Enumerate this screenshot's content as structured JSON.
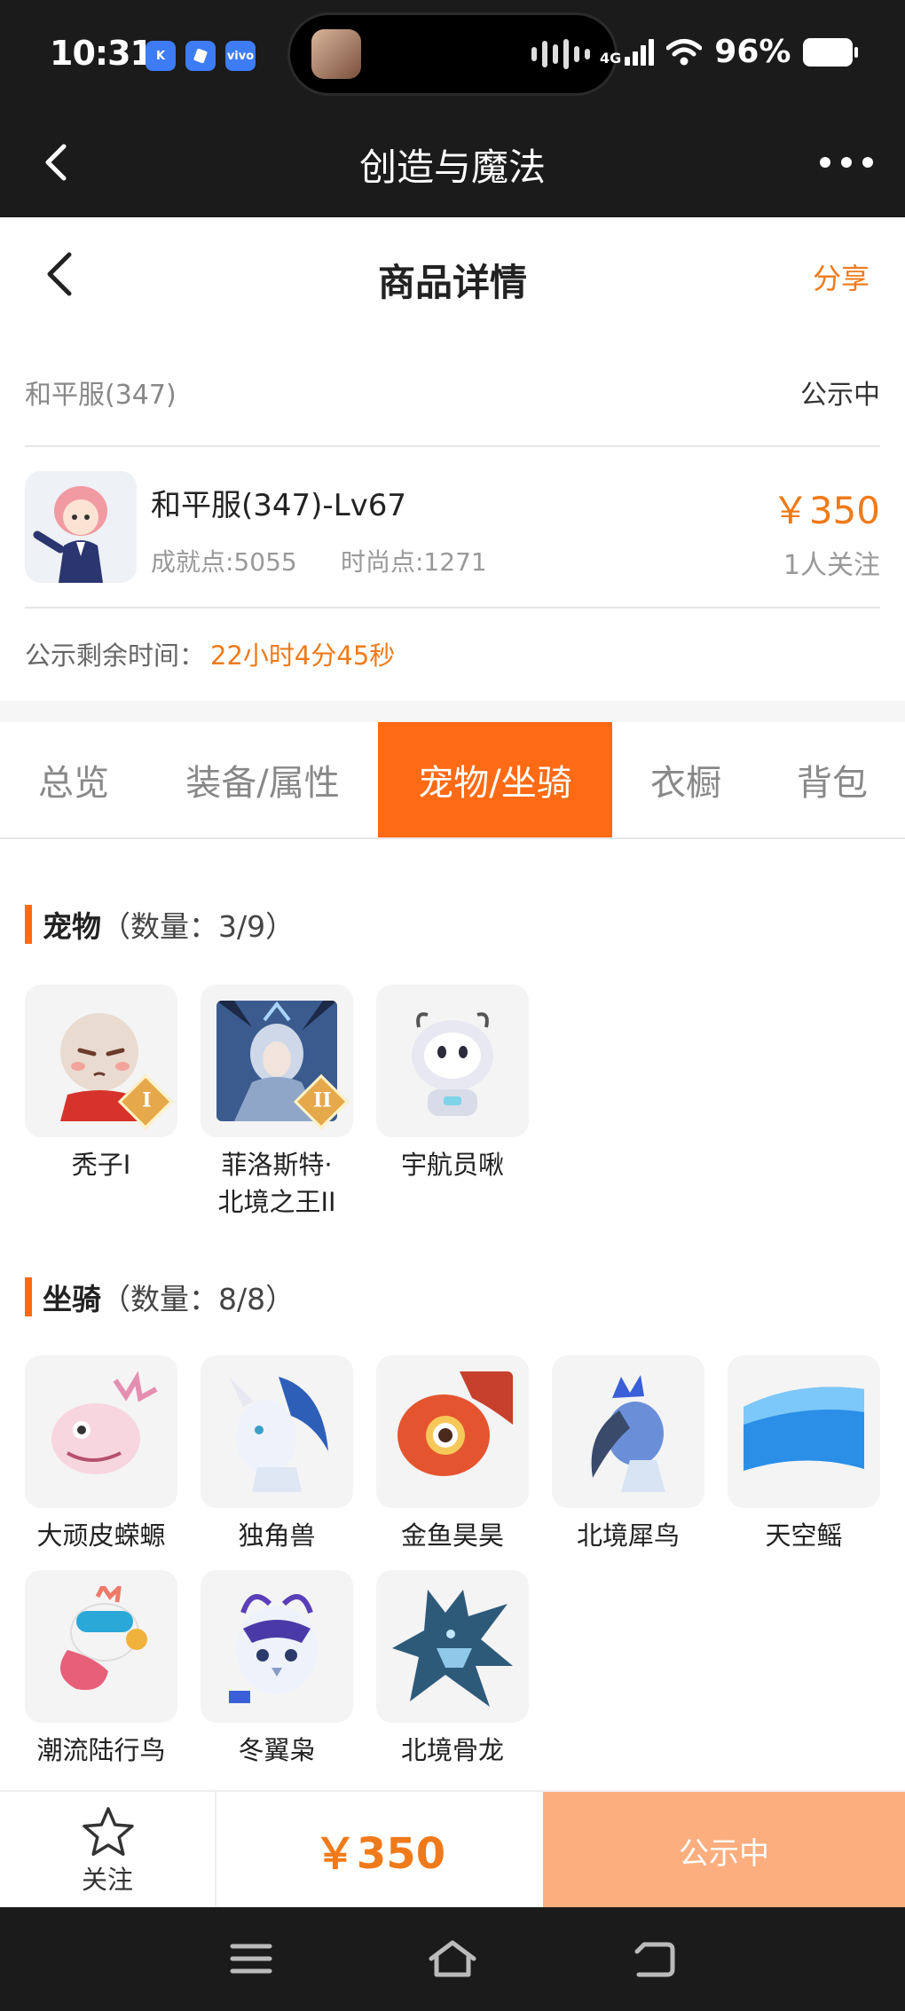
{
  "status_bar": {
    "time": "10:31",
    "apps": [
      "K",
      "",
      "vivo"
    ],
    "network": "4G",
    "battery": "96%"
  },
  "app_header": {
    "title": "创造与魔法"
  },
  "page_header": {
    "title": "商品详情",
    "share_label": "分享"
  },
  "listing": {
    "server": "和平服(347)",
    "status": "公示中",
    "name": "和平服(347)-Lv67",
    "achievement": "成就点:5055",
    "fashion": "时尚点:1271",
    "price": "￥350",
    "followers": "1人关注",
    "remaining_label": "公示剩余时间：",
    "remaining_time": "22小时4分45秒"
  },
  "tabs": [
    {
      "label": "总览",
      "active": false
    },
    {
      "label": "装备/属性",
      "active": false
    },
    {
      "label": "宠物/坐骑",
      "active": true
    },
    {
      "label": "衣橱",
      "active": false
    },
    {
      "label": "背包",
      "active": false
    }
  ],
  "pets": {
    "title": "宠物",
    "count": "（数量：3/9）",
    "items": [
      {
        "line1": "秃子I",
        "line2": "",
        "badge": "I",
        "icon": "bald-pet-icon"
      },
      {
        "line1": "菲洛斯特·",
        "line2": "北境之王II",
        "badge": "II",
        "icon": "frost-king-icon"
      },
      {
        "line1": "宇航员啾",
        "line2": "",
        "badge": "",
        "icon": "astronaut-icon"
      }
    ]
  },
  "mounts": {
    "title": "坐骑",
    "count": "（数量：8/8）",
    "items": [
      {
        "label": "大顽皮蝾螈",
        "icon": "axolotl-icon"
      },
      {
        "label": "独角兽",
        "icon": "unicorn-icon"
      },
      {
        "label": "金鱼昊昊",
        "icon": "goldfish-icon"
      },
      {
        "label": "北境犀鸟",
        "icon": "hornbill-icon"
      },
      {
        "label": "天空鳐",
        "icon": "sky-ray-icon"
      },
      {
        "label": "潮流陆行鸟",
        "icon": "trendy-bird-icon"
      },
      {
        "label": "冬翼枭",
        "icon": "winter-owl-icon"
      },
      {
        "label": "北境骨龙",
        "icon": "bone-dragon-icon"
      }
    ]
  },
  "action_bar": {
    "follow_label": "关注",
    "price": "￥350",
    "status_label": "公示中"
  },
  "colors": {
    "accent": "#ff6a14",
    "price": "#f07a1a",
    "status_button": "#fcae7e",
    "dark_bar": "#1b1b1b"
  }
}
